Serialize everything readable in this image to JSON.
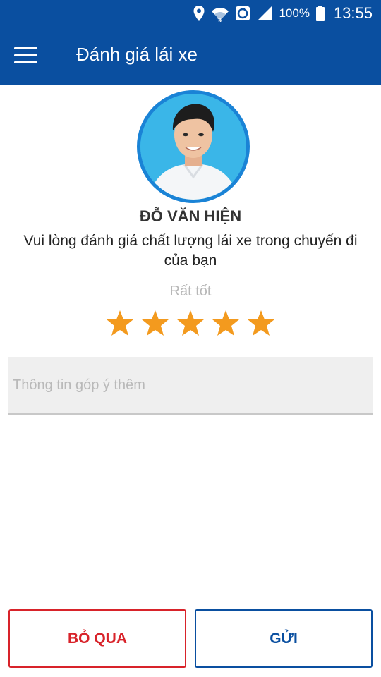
{
  "status_bar": {
    "battery_percent": "100%",
    "time": "13:55",
    "icons": [
      "location-icon",
      "wifi-icon",
      "sync-icon",
      "signal-icon",
      "battery-icon"
    ]
  },
  "app_bar": {
    "title": "Đánh giá lái xe",
    "menu_icon": "hamburger-menu-icon",
    "background": "#0a4fa0"
  },
  "driver": {
    "name": "ĐỖ VĂN HIỆN"
  },
  "prompt": "Vui lòng đánh giá chất lượng lái xe trong chuyến đi của bạn",
  "rating": {
    "label": "Rất tốt",
    "value": 5,
    "max": 5,
    "star_color": "#f39a1e"
  },
  "feedback": {
    "placeholder": "Thông tin góp ý thêm",
    "value": ""
  },
  "buttons": {
    "skip_label": "BỎ QUA",
    "send_label": "GỬI",
    "skip_color": "#d8232a",
    "send_color": "#0a4fa0"
  }
}
